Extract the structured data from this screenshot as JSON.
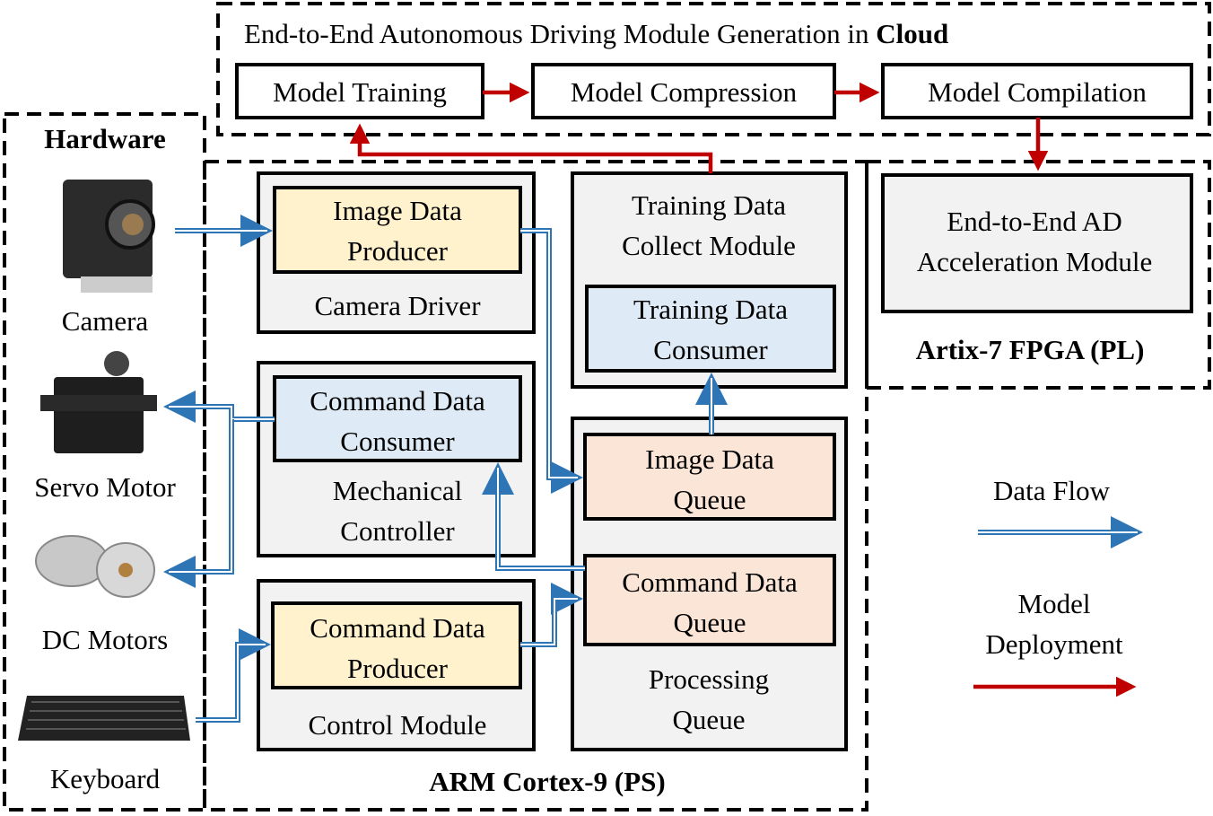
{
  "colors": {
    "panel": "#f2f2f2",
    "producer": "#fff2cc",
    "consumer": "#deebf7",
    "queue": "#fbe5d6",
    "data_flow": "#2e75b6",
    "deployment": "#c00000"
  },
  "cloud": {
    "title_prefix": "End-to-End Autonomous Driving Module Generation in ",
    "title_bold": "Cloud",
    "steps": [
      "Model Training",
      "Model Compression",
      "Model Compilation"
    ]
  },
  "hardware": {
    "title": "Hardware",
    "devices": [
      {
        "label": "Camera",
        "icon": "camera-icon"
      },
      {
        "label": "Servo Motor",
        "icon": "servo-motor-icon"
      },
      {
        "label": "DC Motors",
        "icon": "dc-motors-icon"
      },
      {
        "label": "Keyboard",
        "icon": "keyboard-icon"
      }
    ]
  },
  "arm": {
    "label": "ARM Cortex-9 (PS)",
    "camera_driver": {
      "label": "Camera Driver",
      "inner": [
        "Image Data",
        "Producer"
      ]
    },
    "mechanical_controller": {
      "label": [
        "Mechanical",
        "Controller"
      ],
      "inner": [
        "Command Data",
        "Consumer"
      ]
    },
    "control_module": {
      "label": "Control Module",
      "inner": [
        "Command Data",
        "Producer"
      ]
    },
    "training_collect": {
      "label": [
        "Training Data",
        "Collect Module"
      ],
      "inner": [
        "Training Data",
        "Consumer"
      ]
    },
    "processing_queue": {
      "label": [
        "Processing",
        "Queue"
      ],
      "image_queue": [
        "Image Data",
        "Queue"
      ],
      "command_queue": [
        "Command Data",
        "Queue"
      ]
    }
  },
  "fpga": {
    "label": "Artix-7 FPGA (PL)",
    "module": [
      "End-to-End AD",
      "Acceleration Module"
    ]
  },
  "legend": {
    "data_flow": "Data Flow",
    "deployment": [
      "Model",
      "Deployment"
    ]
  }
}
